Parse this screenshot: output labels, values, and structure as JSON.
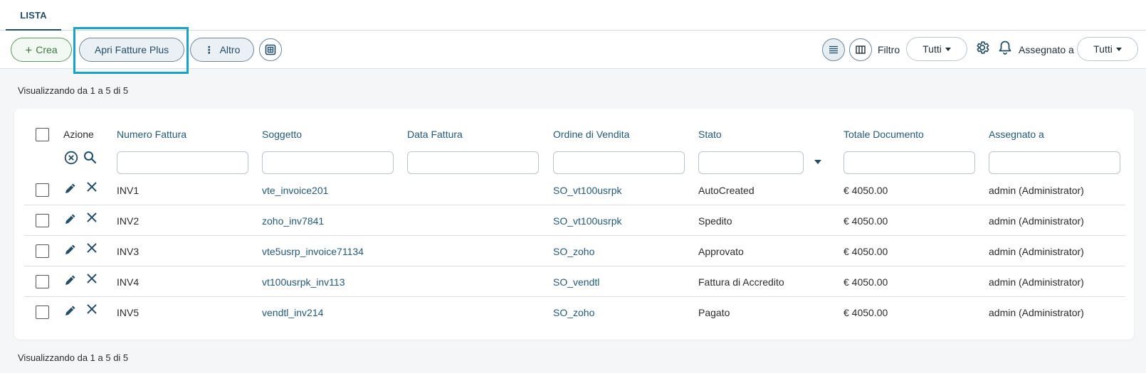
{
  "tabs": [
    {
      "label": "LISTA",
      "active": true
    }
  ],
  "toolbar": {
    "create_label": "Crea",
    "open_label": "Apri Fatture Plus",
    "more_label": "Altro",
    "filter_label": "Filtro",
    "filter_value": "Tutti",
    "assigned_label": "Assegnato a",
    "assigned_value": "Tutti"
  },
  "summary": "Visualizzando da 1 a 5 di 5",
  "table": {
    "columns": [
      "Azione",
      "Numero Fattura",
      "Soggetto",
      "Data Fattura",
      "Ordine di Vendita",
      "Stato",
      "Totale Documento",
      "Assegnato a"
    ],
    "rows": [
      {
        "numero": "INV1",
        "soggetto": "vte_invoice201",
        "data": "",
        "ordine": "SO_vt100usrpk",
        "stato": "AutoCreated",
        "totale": "€ 4050.00",
        "assegnato": "admin (Administrator)"
      },
      {
        "numero": "INV2",
        "soggetto": "zoho_inv7841",
        "data": "",
        "ordine": "SO_vt100usrpk",
        "stato": "Spedito",
        "totale": "€ 4050.00",
        "assegnato": "admin (Administrator)"
      },
      {
        "numero": "INV3",
        "soggetto": "vte5usrp_invoice71134",
        "data": "",
        "ordine": "SO_zoho",
        "stato": "Approvato",
        "totale": "€ 4050.00",
        "assegnato": "admin (Administrator)"
      },
      {
        "numero": "INV4",
        "soggetto": "vt100usrpk_inv113",
        "data": "",
        "ordine": "SO_vendtl",
        "stato": "Fattura di Accredito",
        "totale": "€ 4050.00",
        "assegnato": "admin (Administrator)"
      },
      {
        "numero": "INV5",
        "soggetto": "vendtl_inv214",
        "data": "",
        "ordine": "SO_zoho",
        "stato": "Pagato",
        "totale": "€ 4050.00",
        "assegnato": "admin (Administrator)"
      }
    ]
  },
  "colors": {
    "accent": "#1f4e6b",
    "link": "#1f5a7a",
    "create_green": "#3d7a3d",
    "highlight": "#1aa3c9"
  }
}
